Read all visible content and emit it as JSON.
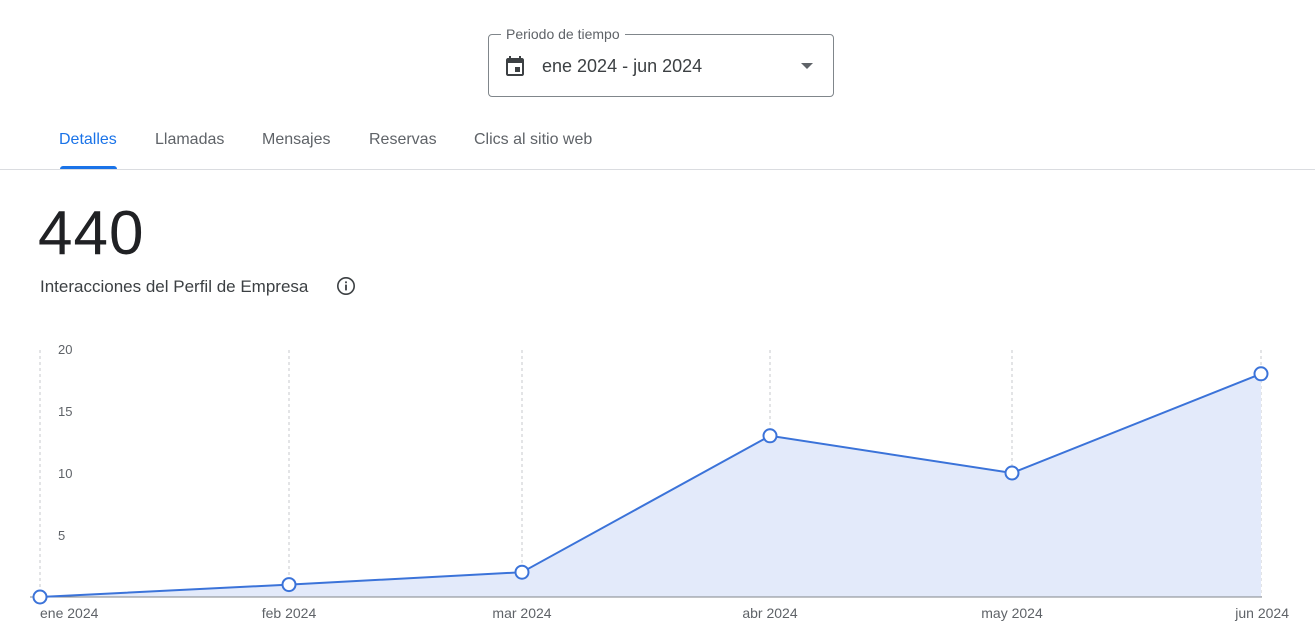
{
  "period_selector": {
    "legend": "Periodo de tiempo",
    "value": "ene 2024 - jun 2024",
    "icon": "calendar-icon"
  },
  "tabs": [
    {
      "label": "Detalles",
      "active": true
    },
    {
      "label": "Llamadas",
      "active": false
    },
    {
      "label": "Mensajes",
      "active": false
    },
    {
      "label": "Reservas",
      "active": false
    },
    {
      "label": "Clics al sitio web",
      "active": false
    }
  ],
  "summary": {
    "total": "440",
    "label": "Interacciones del Perfil de Empresa",
    "info_icon": "info-icon"
  },
  "colors": {
    "accent": "#1a73e8",
    "line": "#3b73d9",
    "area": "#e3eafa"
  },
  "chart_data": {
    "type": "area",
    "categories": [
      "ene 2024",
      "feb 2024",
      "mar 2024",
      "abr 2024",
      "may 2024",
      "jun 2024"
    ],
    "values": [
      0,
      1,
      2,
      13,
      10,
      18
    ],
    "yticks": [
      5,
      10,
      15,
      20
    ],
    "ylim": [
      0,
      20
    ],
    "grid": "vertical-dashed"
  }
}
